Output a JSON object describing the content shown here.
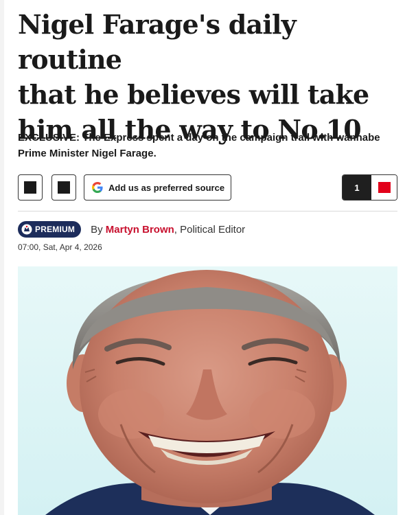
{
  "article": {
    "headline_lines": [
      "Nigel Farage's daily routine",
      "that he believes will take",
      "him all the way to No.10"
    ],
    "standfirst_prefix": "EXCLUSIVE:",
    "standfirst_text": " The Express spent a day on the campaign trail with wannabe Prime Minister Nigel Farage."
  },
  "share_bar": {
    "preferred_source_label": "Add us as preferred source",
    "comment_count": "1"
  },
  "byline": {
    "badge_label": "PREMIUM",
    "by_prefix": "By ",
    "author": "Martyn Brown",
    "role": ", Political Editor",
    "timestamp": "07:00, Sat, Apr 4, 2026"
  },
  "hero_image": {
    "subject": "Nigel Farage smiling"
  },
  "colors": {
    "accent_red": "#e2001a",
    "author_red": "#c8102e",
    "premium_navy": "#1c2c5b",
    "hero_background": "#d4f1f3"
  },
  "icons": [
    "share-square-icon",
    "google-g-icon",
    "comment-bubble-icon",
    "premium-crest-icon"
  ]
}
